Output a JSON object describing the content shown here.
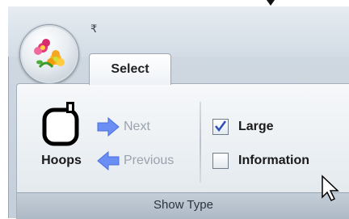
{
  "ribbon": {
    "active_tab": "Select",
    "qat_glyph": "₹",
    "app_icon": "flowers-logo-icon",
    "group_label": "Show Type",
    "hoops_label": "Hoops",
    "next_label": "Next",
    "previous_label": "Previous",
    "options": [
      {
        "label": "Large",
        "checked": true
      },
      {
        "label": "Information",
        "checked": false
      }
    ],
    "colors": {
      "nav_arrow": "#6b8ef5",
      "disabled_text": "#9aa3ad"
    }
  }
}
